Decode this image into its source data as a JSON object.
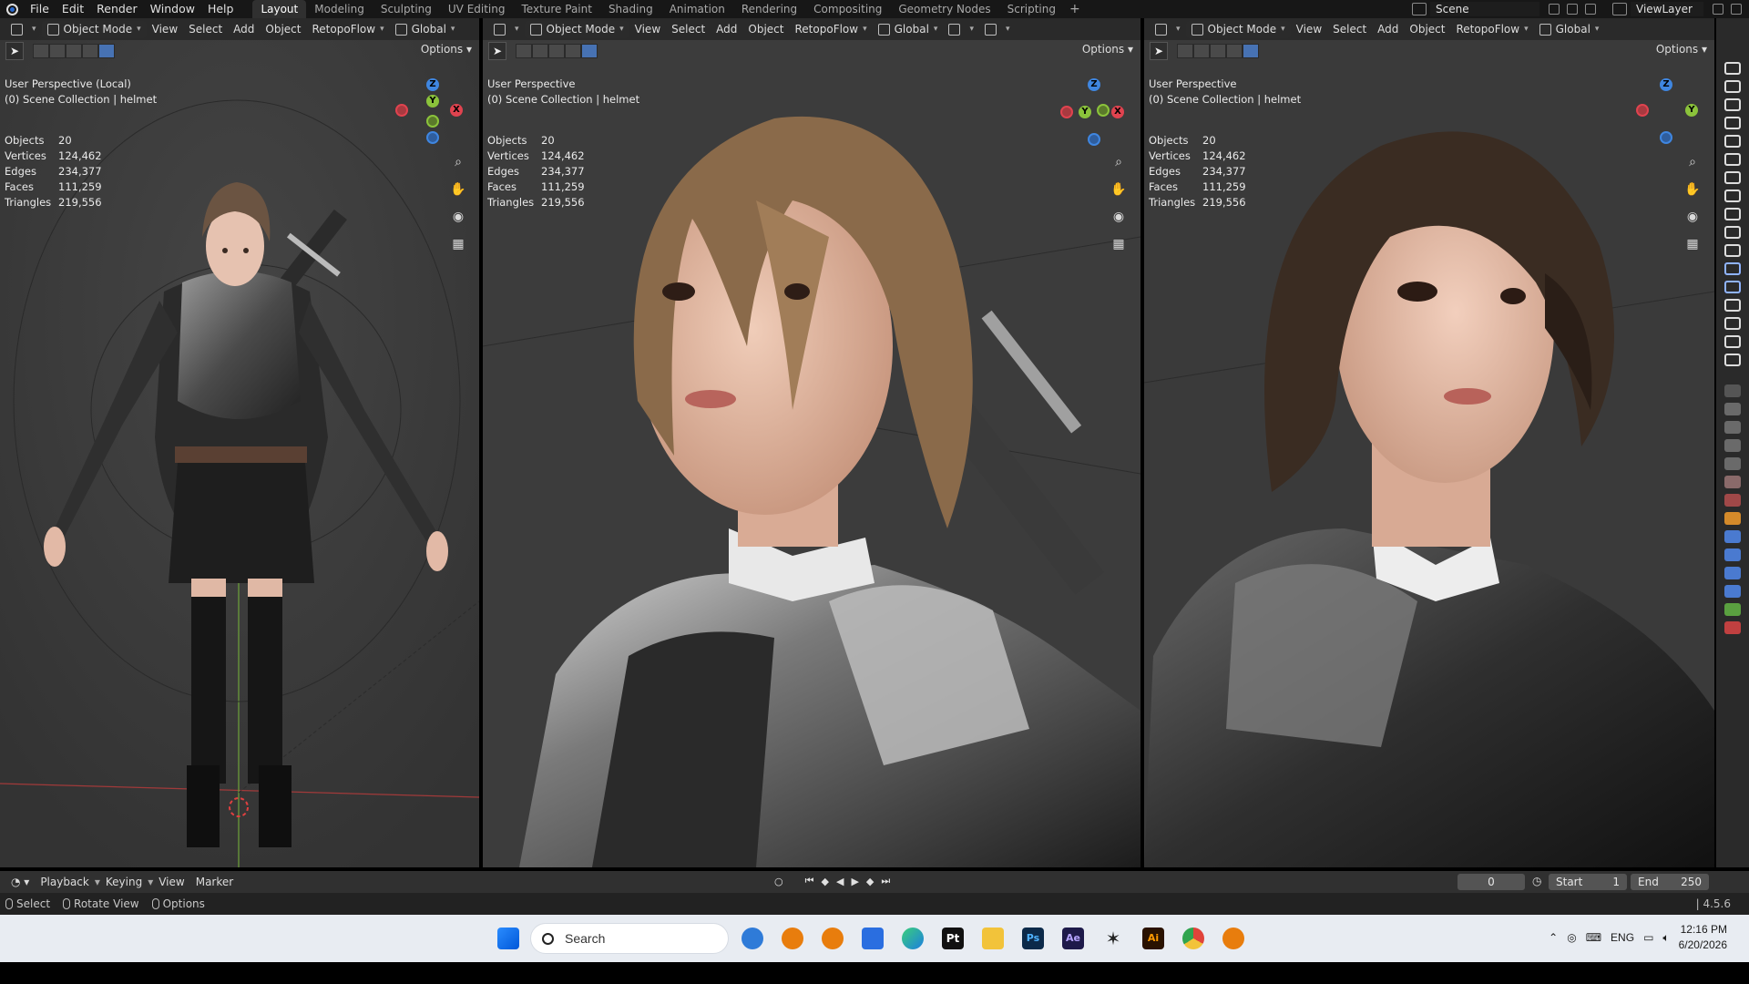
{
  "topbar": {
    "menus": [
      "File",
      "Edit",
      "Render",
      "Window",
      "Help"
    ],
    "workspaces": [
      "Layout",
      "Modeling",
      "Sculpting",
      "UV Editing",
      "Texture Paint",
      "Shading",
      "Animation",
      "Rendering",
      "Compositing",
      "Geometry Nodes",
      "Scripting"
    ],
    "active_workspace": "Layout",
    "scene_name": "Scene",
    "view_layer": "ViewLayer"
  },
  "viewport_header": {
    "mode": "Object Mode",
    "menus": [
      "View",
      "Select",
      "Add",
      "Object"
    ],
    "addon": "RetopoFlow",
    "orientation": "Global",
    "options_label": "Options"
  },
  "viewports": [
    {
      "title": "User Perspective (Local)",
      "collection": "(0) Scene Collection | helmet",
      "stats": {
        "Objects": "20",
        "Vertices": "124,462",
        "Edges": "234,377",
        "Faces": "111,259",
        "Triangles": "219,556"
      }
    },
    {
      "title": "User Perspective",
      "collection": "(0) Scene Collection | helmet",
      "stats": {
        "Objects": "20",
        "Vertices": "124,462",
        "Edges": "234,377",
        "Faces": "111,259",
        "Triangles": "219,556"
      }
    },
    {
      "title": "User Perspective",
      "collection": "(0) Scene Collection | helmet",
      "stats": {
        "Objects": "20",
        "Vertices": "124,462",
        "Edges": "234,377",
        "Faces": "111,259",
        "Triangles": "219,556"
      }
    }
  ],
  "stat_labels": [
    "Objects",
    "Vertices",
    "Edges",
    "Faces",
    "Triangles"
  ],
  "gizmo_labels": {
    "x": "X",
    "y": "Y",
    "z": "Z"
  },
  "timeline": {
    "menus": [
      "Playback",
      "Keying",
      "View",
      "Marker"
    ],
    "current_frame": "0",
    "start_label": "Start",
    "start": "1",
    "end_label": "End",
    "end": "250"
  },
  "statusbar": {
    "items": [
      "Select",
      "Rotate View",
      "Options"
    ],
    "version": "4.5.6"
  },
  "taskbar": {
    "search_placeholder": "Search",
    "language": "ENG",
    "time": "12:16 PM",
    "date": "6/20/2026",
    "pinned_app_labels": {
      "pt": "Pt",
      "ps": "Ps",
      "ae": "Ae",
      "ai": "Ai"
    }
  },
  "colors": {
    "accent": "#4772b3",
    "viewport_bg": "#3b3b3b",
    "axis_x": "#e0434f",
    "axis_y": "#8bc33b",
    "axis_z": "#3f86e0"
  },
  "icons": {
    "nav": [
      "zoom-icon",
      "hand-pan-icon",
      "camera-icon",
      "grid-perspective-icon"
    ]
  }
}
